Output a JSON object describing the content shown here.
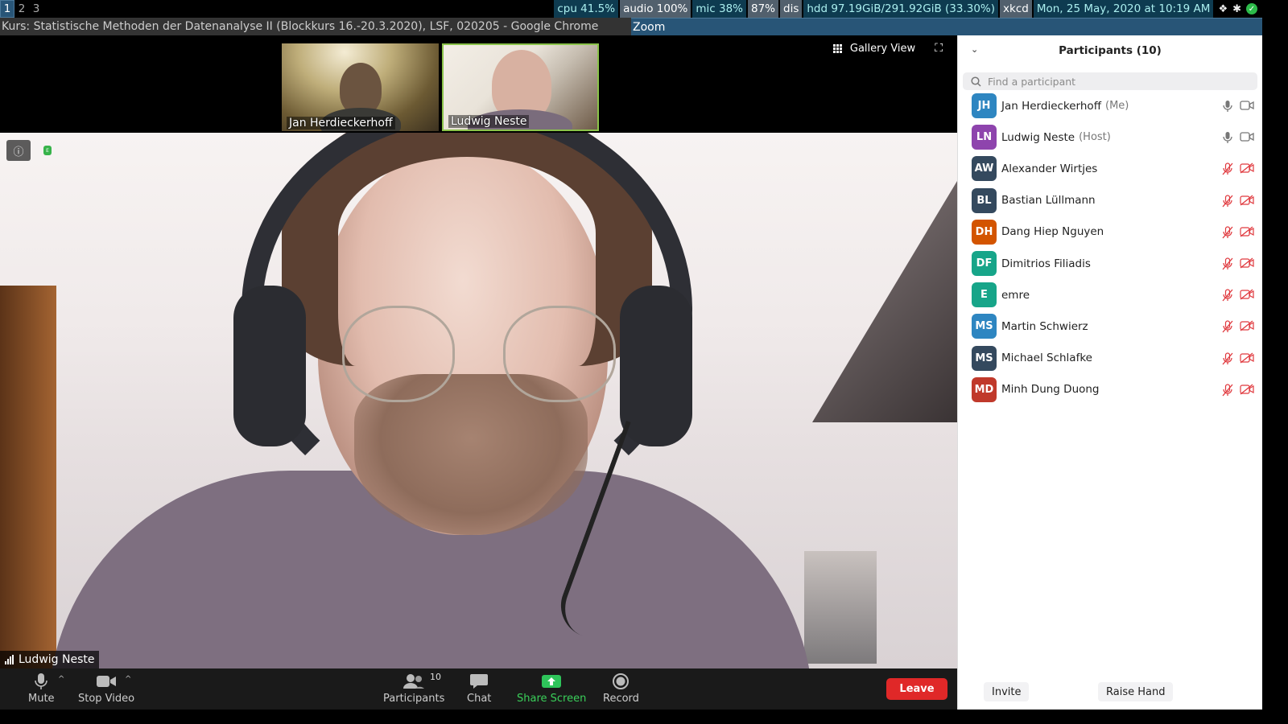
{
  "statusbar": {
    "workspaces": [
      "1",
      "2",
      "3"
    ],
    "cpu": "cpu 41.5%",
    "audio": "audio 100%",
    "mic": "mic 38%",
    "battery": "87%",
    "dis": "dis",
    "hdd": "hdd 97.19GiB/291.92GiB (33.30%)",
    "xkcd": "xkcd",
    "datetime": "Mon, 25 May, 2020 at 10:19 AM"
  },
  "titlebar": {
    "chrome_title": "Kurs: Statistische Methoden der Datenanalyse II (Blockkurs 16.-20.3.2020), LSF, 020205 - Google Chrome",
    "zoom_title": "Zoom"
  },
  "video": {
    "gallery_view_label": "Gallery View",
    "thumbnails": [
      {
        "name": "Jan Herdieckerhoff"
      },
      {
        "name": "Ludwig Neste"
      }
    ],
    "active_speaker": "Ludwig Neste"
  },
  "toolbar": {
    "mute": "Mute",
    "stop_video": "Stop Video",
    "participants": "Participants",
    "participants_count": "10",
    "chat": "Chat",
    "share_screen": "Share Screen",
    "record": "Record",
    "leave": "Leave"
  },
  "panel": {
    "title": "Participants (10)",
    "search_placeholder": "Find a participant",
    "participants": [
      {
        "initials": "JH",
        "name": "Jan Herdieckerhoff",
        "tag": "(Me)",
        "color": "#2e86c1",
        "muted": false
      },
      {
        "initials": "LN",
        "name": "Ludwig Neste",
        "tag": "(Host)",
        "color": "#8e44ad",
        "muted": false
      },
      {
        "initials": "AW",
        "name": "Alexander Wirtjes",
        "tag": "",
        "color": "#34495e",
        "muted": true
      },
      {
        "initials": "BL",
        "name": "Bastian Lüllmann",
        "tag": "",
        "color": "#34495e",
        "muted": true
      },
      {
        "initials": "DH",
        "name": "Dang Hiep Nguyen",
        "tag": "",
        "color": "#d35400",
        "muted": true
      },
      {
        "initials": "DF",
        "name": "Dimitrios Filiadis",
        "tag": "",
        "color": "#17a589",
        "muted": true
      },
      {
        "initials": "E",
        "name": "emre",
        "tag": "",
        "color": "#17a589",
        "muted": true
      },
      {
        "initials": "MS",
        "name": "Martin Schwierz",
        "tag": "",
        "color": "#2e86c1",
        "muted": true
      },
      {
        "initials": "MS",
        "name": "Michael Schlafke",
        "tag": "",
        "color": "#34495e",
        "muted": true
      },
      {
        "initials": "MD",
        "name": "Minh Dung Duong",
        "tag": "",
        "color": "#c0392b",
        "muted": true
      }
    ],
    "invite": "Invite",
    "raise_hand": "Raise Hand"
  }
}
